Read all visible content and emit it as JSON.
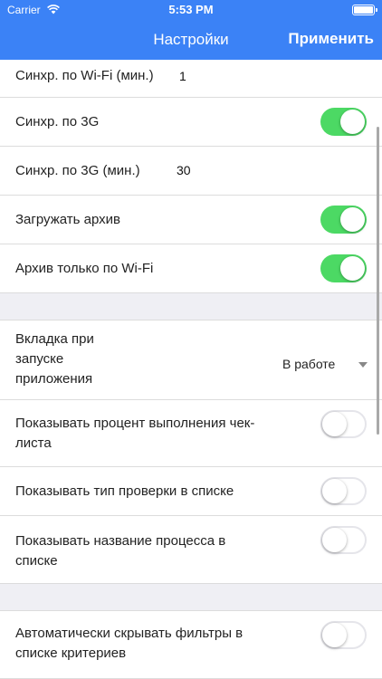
{
  "status_bar": {
    "carrier": "Carrier",
    "time": "5:53 PM"
  },
  "header": {
    "title": "Настройки",
    "apply_label": "Применить"
  },
  "settings": {
    "wifi_sync_label": "Синхр. по Wi-Fi (мин.)",
    "wifi_sync_value": "1",
    "sync_3g_label": "Синхр. по 3G",
    "sync_3g_on": true,
    "sync_3g_min_label": "Синхр. по 3G (мин.)",
    "sync_3g_min_value": "30",
    "load_archive_label": "Загружать архив",
    "load_archive_on": true,
    "archive_wifi_label": "Архив только по Wi-Fi",
    "archive_wifi_on": true,
    "start_tab_label_1": "Вкладка при",
    "start_tab_label_2": "запуске",
    "start_tab_label_3": "приложения",
    "start_tab_value": "В работе",
    "show_percent_label_1": "Показывать процент выполнения чек-",
    "show_percent_label_2": "листа",
    "show_percent_on": false,
    "show_check_type_label": "Показывать тип проверки в списке",
    "show_check_type_on": false,
    "show_process_label_1": "Показывать название процесса в",
    "show_process_label_2": "списке",
    "show_process_on": false,
    "auto_hide_label_1": "Автоматически скрывать фильтры в",
    "auto_hide_label_2": "списке критериев",
    "auto_hide_on": false
  },
  "colors": {
    "header": "#3b82f6",
    "toggle_on": "#4cd964",
    "section_gap": "#efeff4"
  }
}
